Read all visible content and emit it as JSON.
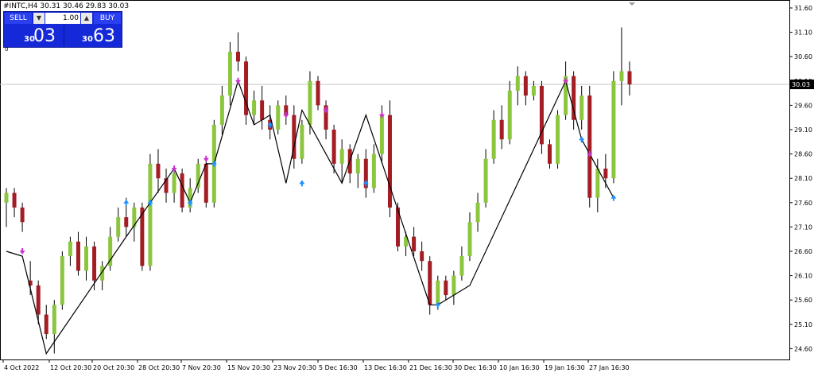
{
  "header": {
    "text": "#INTC,H4  30.31 30.46 29.83 30.03"
  },
  "trade_panel": {
    "sell_label": "SELL",
    "buy_label": "BUY",
    "lot_value": "1.00",
    "sell_price_prefix": "30",
    "sell_price_big": "03",
    "buy_price_prefix": "30",
    "buy_price_big": "63",
    "zero_label": "0"
  },
  "colors": {
    "bull": "#8cc63f",
    "bear": "#a31d24",
    "grid": "#e6e6e6",
    "line": "#000000",
    "current_price_box": "#000000",
    "up_arrow": "#1e90ff",
    "down_arrow": "#cc33cc"
  },
  "chart_data": {
    "type": "candlestick",
    "symbol": "#INTC",
    "timeframe": "H4",
    "ylim": [
      24.3,
      31.35
    ],
    "y_ticks": [
      "31.60",
      "31.10",
      "30.60",
      "30.10",
      "29.60",
      "29.10",
      "28.60",
      "28.10",
      "27.60",
      "27.10",
      "26.60",
      "26.10",
      "25.60",
      "25.10",
      "24.60"
    ],
    "x_labels": [
      "4 Oct 2022",
      "12 Oct 20:30",
      "20 Oct 20:30",
      "28 Oct 20:30",
      "7 Nov 20:30",
      "15 Nov 20:30",
      "23 Nov 20:30",
      "5 Dec 16:30",
      "13 Dec 16:30",
      "21 Dec 16:30",
      "30 Dec 16:30",
      "10 Jan 16:30",
      "19 Jan 16:30",
      "27 Jan 16:30"
    ],
    "current_price": 30.03,
    "current_price_label": "30.03",
    "candles": [
      [
        27.6,
        27.9,
        27.1,
        27.8
      ],
      [
        27.8,
        27.9,
        27.3,
        27.5
      ],
      [
        27.5,
        27.6,
        27.0,
        27.2
      ],
      [
        26.0,
        26.4,
        25.7,
        25.9
      ],
      [
        25.9,
        26.0,
        25.1,
        25.3
      ],
      [
        25.3,
        25.5,
        24.8,
        24.9
      ],
      [
        24.9,
        25.6,
        24.5,
        25.5
      ],
      [
        25.5,
        26.6,
        25.4,
        26.5
      ],
      [
        26.5,
        26.9,
        26.3,
        26.8
      ],
      [
        26.8,
        27.0,
        26.1,
        26.2
      ],
      [
        26.2,
        26.9,
        26.0,
        26.7
      ],
      [
        26.7,
        26.8,
        25.8,
        26.0
      ],
      [
        26.0,
        26.4,
        25.8,
        26.3
      ],
      [
        26.3,
        27.1,
        26.2,
        26.9
      ],
      [
        26.9,
        27.5,
        26.8,
        27.3
      ],
      [
        27.3,
        27.7,
        26.9,
        27.1
      ],
      [
        27.1,
        27.6,
        26.8,
        27.5
      ],
      [
        27.5,
        27.6,
        26.2,
        26.3
      ],
      [
        26.3,
        28.6,
        26.2,
        28.4
      ],
      [
        28.4,
        28.7,
        27.8,
        28.1
      ],
      [
        28.1,
        28.3,
        27.6,
        27.8
      ],
      [
        27.8,
        28.3,
        27.6,
        28.2
      ],
      [
        28.2,
        28.3,
        27.4,
        27.5
      ],
      [
        27.5,
        28.1,
        27.4,
        27.9
      ],
      [
        27.9,
        28.5,
        27.8,
        28.4
      ],
      [
        28.4,
        28.5,
        27.5,
        27.6
      ],
      [
        27.6,
        29.3,
        27.5,
        29.2
      ],
      [
        29.2,
        30.0,
        29.0,
        29.8
      ],
      [
        29.8,
        30.9,
        29.6,
        30.7
      ],
      [
        30.7,
        31.1,
        30.3,
        30.5
      ],
      [
        30.5,
        30.6,
        29.2,
        29.4
      ],
      [
        29.4,
        29.9,
        29.2,
        29.7
      ],
      [
        29.7,
        30.0,
        29.1,
        29.3
      ],
      [
        29.3,
        29.6,
        28.9,
        29.1
      ],
      [
        29.1,
        29.7,
        29.0,
        29.6
      ],
      [
        29.6,
        29.8,
        29.2,
        29.4
      ],
      [
        29.4,
        29.6,
        28.3,
        28.5
      ],
      [
        28.5,
        29.3,
        28.4,
        29.2
      ],
      [
        29.2,
        30.3,
        29.0,
        30.1
      ],
      [
        30.1,
        30.2,
        29.5,
        29.6
      ],
      [
        29.6,
        29.7,
        28.9,
        29.1
      ],
      [
        29.1,
        29.2,
        28.2,
        28.4
      ],
      [
        28.4,
        28.9,
        28.0,
        28.7
      ],
      [
        28.7,
        28.8,
        28.0,
        28.2
      ],
      [
        28.2,
        28.6,
        27.9,
        28.5
      ],
      [
        28.5,
        28.7,
        27.7,
        27.9
      ],
      [
        27.9,
        28.8,
        27.8,
        28.6
      ],
      [
        28.6,
        29.6,
        28.4,
        29.4
      ],
      [
        29.4,
        29.7,
        27.3,
        27.5
      ],
      [
        27.5,
        27.6,
        26.6,
        26.7
      ],
      [
        26.7,
        27.0,
        26.5,
        26.9
      ],
      [
        26.9,
        27.1,
        26.5,
        26.6
      ],
      [
        26.6,
        26.8,
        26.2,
        26.4
      ],
      [
        26.4,
        26.5,
        25.3,
        25.5
      ],
      [
        25.5,
        26.1,
        25.4,
        26.0
      ],
      [
        26.0,
        26.1,
        25.6,
        25.7
      ],
      [
        25.7,
        26.2,
        25.5,
        26.1
      ],
      [
        26.1,
        26.7,
        26.0,
        26.5
      ],
      [
        26.5,
        27.4,
        26.4,
        27.2
      ],
      [
        27.2,
        27.8,
        27.0,
        27.6
      ],
      [
        27.6,
        28.7,
        27.5,
        28.5
      ],
      [
        28.5,
        29.5,
        28.4,
        29.3
      ],
      [
        29.3,
        29.6,
        28.7,
        28.9
      ],
      [
        28.9,
        30.1,
        28.8,
        29.9
      ],
      [
        29.9,
        30.4,
        29.6,
        30.2
      ],
      [
        30.2,
        30.3,
        29.6,
        29.8
      ],
      [
        29.8,
        30.1,
        29.7,
        30.0
      ],
      [
        30.0,
        30.1,
        28.6,
        28.8
      ],
      [
        28.8,
        28.9,
        28.3,
        28.4
      ],
      [
        28.4,
        29.5,
        28.3,
        29.4
      ],
      [
        29.4,
        30.5,
        29.3,
        30.2
      ],
      [
        30.2,
        30.3,
        29.1,
        29.3
      ],
      [
        29.3,
        30.0,
        29.1,
        29.8
      ],
      [
        29.8,
        30.0,
        27.5,
        27.7
      ],
      [
        27.7,
        28.5,
        27.4,
        28.3
      ],
      [
        28.3,
        28.6,
        27.9,
        28.1
      ],
      [
        28.1,
        30.3,
        28.0,
        30.1
      ],
      [
        30.1,
        31.2,
        29.6,
        30.3
      ],
      [
        30.3,
        30.5,
        29.8,
        30.03
      ]
    ],
    "zigzag": [
      [
        0,
        26.6
      ],
      [
        2,
        26.5
      ],
      [
        5,
        24.5
      ],
      [
        15,
        26.9
      ],
      [
        18,
        27.6
      ],
      [
        21,
        28.3
      ],
      [
        23,
        27.6
      ],
      [
        25,
        28.4
      ],
      [
        26,
        28.4
      ],
      [
        29,
        30.1
      ],
      [
        31,
        29.2
      ],
      [
        33,
        29.4
      ],
      [
        35,
        28.0
      ],
      [
        37,
        29.5
      ],
      [
        40,
        28.6
      ],
      [
        42,
        28.0
      ],
      [
        45,
        29.4
      ],
      [
        53,
        25.5
      ],
      [
        54,
        25.5
      ],
      [
        58,
        25.9
      ],
      [
        70,
        30.1
      ],
      [
        72,
        28.9
      ],
      [
        73,
        28.6
      ],
      [
        76,
        27.7
      ]
    ],
    "markers": [
      {
        "i": 2,
        "dir": "down",
        "p": 26.6
      },
      {
        "i": 15,
        "dir": "up",
        "p": 27.6
      },
      {
        "i": 18,
        "dir": "up",
        "p": 27.6
      },
      {
        "i": 21,
        "dir": "down",
        "p": 28.3
      },
      {
        "i": 23,
        "dir": "up",
        "p": 27.6
      },
      {
        "i": 25,
        "dir": "down",
        "p": 28.5
      },
      {
        "i": 26,
        "dir": "up",
        "p": 28.4
      },
      {
        "i": 29,
        "dir": "down",
        "p": 30.1
      },
      {
        "i": 33,
        "dir": "up",
        "p": 29.2
      },
      {
        "i": 35,
        "dir": "down",
        "p": 29.4
      },
      {
        "i": 37,
        "dir": "up",
        "p": 28.0
      },
      {
        "i": 40,
        "dir": "down",
        "p": 29.5
      },
      {
        "i": 45,
        "dir": "up",
        "p": 28.0
      },
      {
        "i": 47,
        "dir": "down",
        "p": 29.4
      },
      {
        "i": 54,
        "dir": "up",
        "p": 25.5
      },
      {
        "i": 70,
        "dir": "down",
        "p": 30.1
      },
      {
        "i": 72,
        "dir": "up",
        "p": 28.9
      },
      {
        "i": 73,
        "dir": "down",
        "p": 28.6
      },
      {
        "i": 76,
        "dir": "up",
        "p": 27.7
      }
    ]
  }
}
